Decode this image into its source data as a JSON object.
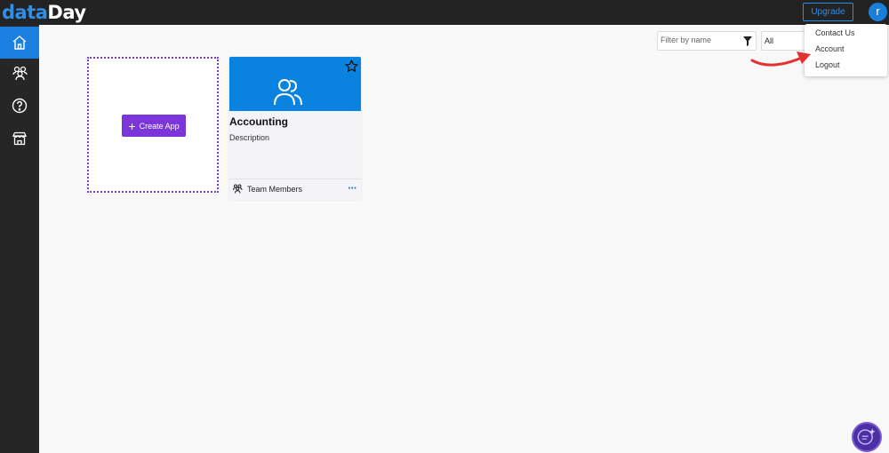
{
  "header": {
    "logo_part1": "data",
    "logo_part2": "Day",
    "upgrade_label": "Upgrade",
    "avatar_initial": "r"
  },
  "sidebar": {
    "items": [
      {
        "icon": "home-icon",
        "active": true
      },
      {
        "icon": "users-icon",
        "active": false
      },
      {
        "icon": "help-icon",
        "active": false
      },
      {
        "icon": "store-icon",
        "active": false
      }
    ]
  },
  "toolbar": {
    "filter_placeholder": "Filter by name",
    "select_value": "All"
  },
  "user_menu": {
    "items": [
      "Contact Us",
      "Account",
      "Logout"
    ]
  },
  "create_card": {
    "button_label": "Create App"
  },
  "apps": [
    {
      "title": "Accounting",
      "description": "Description",
      "footer_label": "Team Members",
      "more": "···"
    }
  ],
  "colors": {
    "accent_blue": "#0a83e0",
    "accent_purple": "#7b35d9",
    "topbar": "#232323",
    "sidebar": "#262626",
    "annotation_arrow": "#e33131"
  }
}
